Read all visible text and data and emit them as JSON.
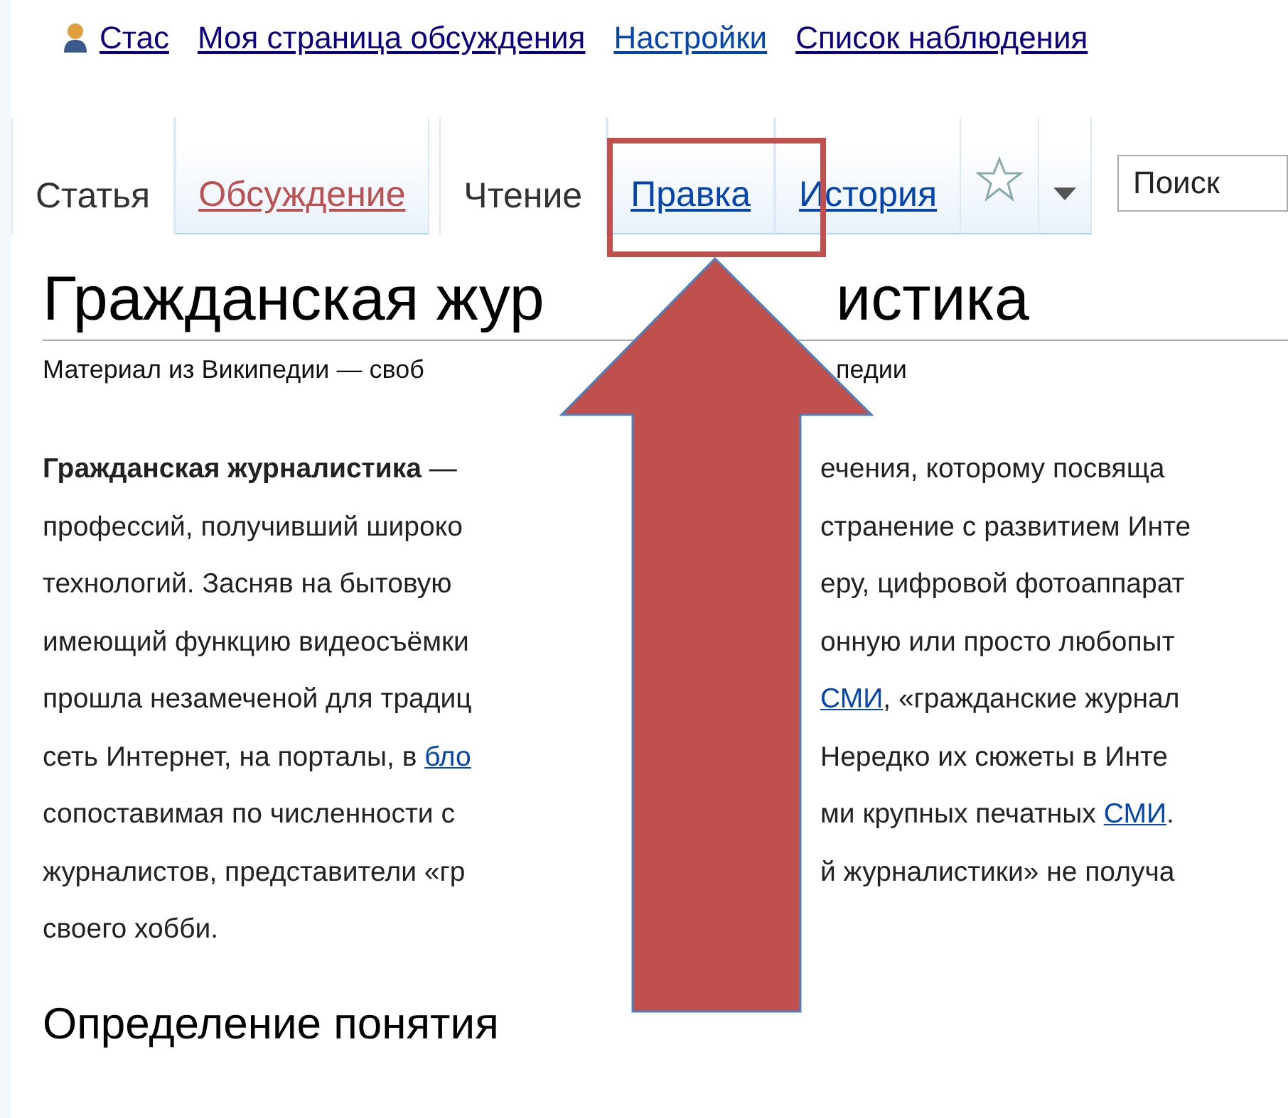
{
  "personal_tools": [
    {
      "label": "Стас",
      "visited": true
    },
    {
      "label": "Моя страница обсуждения",
      "visited": true
    },
    {
      "label": "Настройки",
      "visited": false
    },
    {
      "label": "Список наблюдения",
      "visited": true
    }
  ],
  "namespace_tabs": [
    {
      "label": "Статья",
      "selected": true,
      "missing": false
    },
    {
      "label": "Обсуждение",
      "selected": false,
      "missing": true
    }
  ],
  "view_tabs": [
    {
      "label": "Чтение",
      "selected": true
    },
    {
      "label": "Правка",
      "selected": false
    },
    {
      "label": "История",
      "selected": false
    }
  ],
  "search": {
    "placeholder": "Поиск"
  },
  "article": {
    "title_left": "Гражданская жур",
    "title_right": "истика",
    "subtitle_left": "Материал из Википедии — своб",
    "subtitle_right": "педии",
    "lines": [
      {
        "left": [
          {
            "kind": "text",
            "text": "**Гражданская журналистика** —"
          }
        ],
        "right": [
          {
            "kind": "text",
            "text": "ечения, которому посвяща"
          }
        ]
      },
      {
        "left": [
          {
            "kind": "text",
            "text": "профессий, получивший широко"
          }
        ],
        "right": [
          {
            "kind": "text",
            "text": "странение с развитием Инте"
          }
        ]
      },
      {
        "left": [
          {
            "kind": "text",
            "text": "технологий. Засняв на бытовую"
          }
        ],
        "right": [
          {
            "kind": "text",
            "text": "еру, цифровой фотоаппарат"
          }
        ]
      },
      {
        "left": [
          {
            "kind": "text",
            "text": "имеющий функцию видеосъёмки"
          }
        ],
        "right": [
          {
            "kind": "text",
            "text": "онную или просто любопыт"
          }
        ]
      },
      {
        "left": [
          {
            "kind": "text",
            "text": "прошла незамеченой для традиц"
          }
        ],
        "right": [
          {
            "kind": "link",
            "text": "СМИ"
          },
          {
            "kind": "text",
            "text": ", «гражданские журнал"
          }
        ]
      },
      {
        "left": [
          {
            "kind": "text",
            "text": "сеть Интернет, на порталы, в "
          },
          {
            "kind": "link",
            "text": "бло"
          }
        ],
        "right": [
          {
            "kind": "text",
            "text": "Нередко их сюжеты в Инте"
          }
        ]
      },
      {
        "left": [
          {
            "kind": "text",
            "text": "сопоставимая по численности с"
          }
        ],
        "right": [
          {
            "kind": "text",
            "text": "ми крупных печатных "
          },
          {
            "kind": "link",
            "text": "СМИ"
          },
          {
            "kind": "text",
            "text": "."
          }
        ]
      },
      {
        "left": [
          {
            "kind": "text",
            "text": "журналистов, представители «гр"
          }
        ],
        "right": [
          {
            "kind": "text",
            "text": "й журналистики» не получа"
          }
        ]
      },
      {
        "left": [
          {
            "kind": "text",
            "text": "своего хобби."
          }
        ]
      }
    ],
    "heading": "Определение понятия"
  }
}
